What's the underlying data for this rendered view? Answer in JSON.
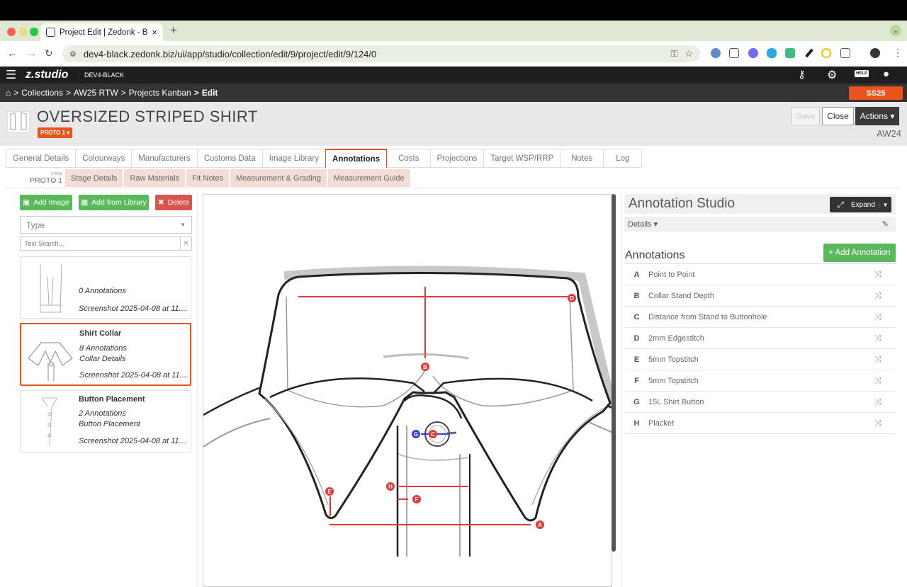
{
  "browser": {
    "tab_title": "Project Edit | Zedonk - Busine",
    "url": "dev4-black.zedonk.biz/ui/app/studio/collection/edit/9/project/edit/9/124/0"
  },
  "app": {
    "logo": "z.studio",
    "env": "DEV4-BLACK",
    "help_label": "HELP"
  },
  "breadcrumb": {
    "home_sep": ">",
    "items": [
      "Collections",
      "AW25 RTW",
      "Projects Kanban"
    ],
    "current": "Edit",
    "season_badge": "SS25"
  },
  "project": {
    "title": "OVERSIZED STRIPED SHIRT",
    "proto_badge": "PROTO 1 ▾",
    "save": "Save",
    "close": "Close",
    "actions": "Actions ▾",
    "season": "AW24"
  },
  "tabs": [
    "General Details",
    "Colourways",
    "Manufacturers",
    "Customs Data",
    "Image Library",
    "Annotations",
    "Costs",
    "Projections",
    "Target WSP/RRP",
    "Notes",
    "Log"
  ],
  "active_tab": "Annotations",
  "subtabs": {
    "stage_label": "STAGE",
    "stage_value": "PROTO 1",
    "items": [
      "Stage Details",
      "Raw Materials",
      "Fit Notes",
      "Measurement & Grading",
      "Measurement Guide"
    ]
  },
  "left": {
    "add_image": "Add Image",
    "add_from_library": "Add from Library",
    "delete": "Delete",
    "type_placeholder": "Type",
    "search_placeholder": "Text Search...",
    "cards": [
      {
        "name": "",
        "annotations": "0 Annotations",
        "subtitle": "",
        "file": "Screenshot 2025-04-08 at 11...."
      },
      {
        "name": "Shirt Collar",
        "annotations": "8 Annotations",
        "subtitle": "Collar Details",
        "file": "Screenshot 2025-04-08 at 11...."
      },
      {
        "name": "Button Placement",
        "annotations": "2 Annotations",
        "subtitle": "Button Placement",
        "file": "Screenshot 2025-04-08 at 11...."
      }
    ]
  },
  "canvas_markers": [
    "A",
    "B",
    "C",
    "D",
    "E",
    "F",
    "G",
    "H"
  ],
  "studio": {
    "title": "Annotation Studio",
    "expand": "Expand",
    "details": "Details ▾",
    "annotations_heading": "Annotations",
    "add_annotation": "+ Add Annotation",
    "annotations": [
      {
        "letter": "A",
        "name": "Point to Point"
      },
      {
        "letter": "B",
        "name": "Collar Stand Depth"
      },
      {
        "letter": "C",
        "name": "Distance from Stand to Buttonhole"
      },
      {
        "letter": "D",
        "name": "2mm Edgestitch"
      },
      {
        "letter": "E",
        "name": "5mm Topstitch"
      },
      {
        "letter": "F",
        "name": "5mm Topstitch"
      },
      {
        "letter": "G",
        "name": "15L Shirt Button"
      },
      {
        "letter": "H",
        "name": "Placket"
      }
    ]
  },
  "colors": {
    "accent": "#e8541b",
    "green": "#5cb85c",
    "delete_red": "#d9534f",
    "annotation_red": "#e53935",
    "annotation_blue": "#3c3cd6"
  }
}
